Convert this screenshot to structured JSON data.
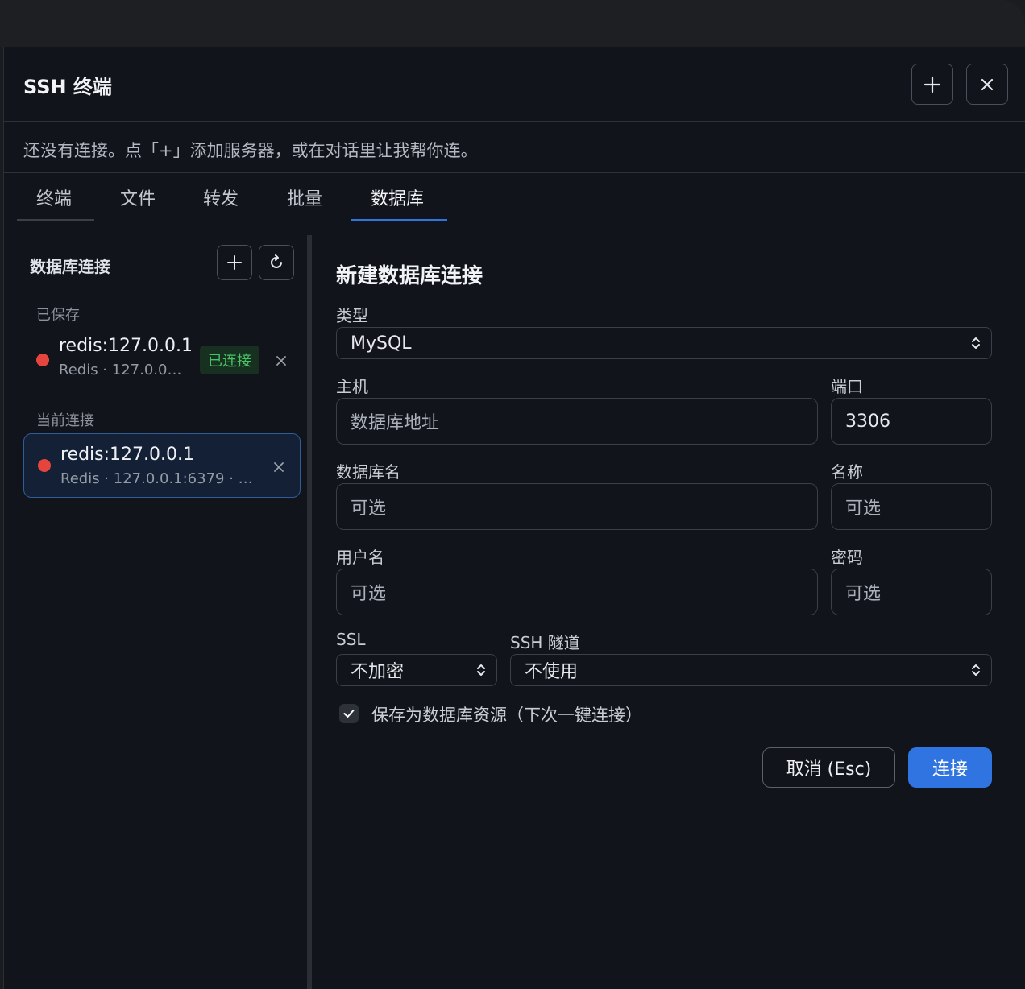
{
  "header": {
    "title": "SSH 终端",
    "add_icon": "plus-icon",
    "close_icon": "close-icon"
  },
  "notice": "还没有连接。点「+」添加服务器，或在对话里让我帮你连。",
  "tabs": [
    {
      "label": "终端"
    },
    {
      "label": "文件"
    },
    {
      "label": "转发"
    },
    {
      "label": "批量"
    },
    {
      "label": "数据库"
    }
  ],
  "active_tab": "数据库",
  "sidebar": {
    "title": "数据库连接",
    "saved_label": "已保存",
    "current_label": "当前连接",
    "saved": [
      {
        "name": "redis:127.0.0.1",
        "sub": "Redis · 127.0.0…",
        "badge": "已连接"
      }
    ],
    "current": [
      {
        "name": "redis:127.0.0.1",
        "sub": "Redis · 127.0.0.1:6379 · …"
      }
    ]
  },
  "form": {
    "title": "新建数据库连接",
    "type_label": "类型",
    "type_value": "MySQL",
    "host_label": "主机",
    "host_placeholder": "数据库地址",
    "port_label": "端口",
    "port_value": "3306",
    "dbname_label": "数据库名",
    "dbname_placeholder": "可选",
    "name_label": "名称",
    "name_placeholder": "可选",
    "username_label": "用户名",
    "username_placeholder": "可选",
    "password_label": "密码",
    "password_placeholder": "可选",
    "ssl_label": "SSL",
    "ssl_value": "不加密",
    "tunnel_label": "SSH 隧道",
    "tunnel_value": "不使用",
    "save_checkbox_label": "保存为数据库资源（下次一键连接）",
    "save_checked": true,
    "cancel_label": "取消 (Esc)",
    "connect_label": "连接"
  },
  "colors": {
    "accent": "#2f74e0",
    "status_error": "#e5453d",
    "status_ok": "#44c466",
    "background": "#11141a"
  }
}
